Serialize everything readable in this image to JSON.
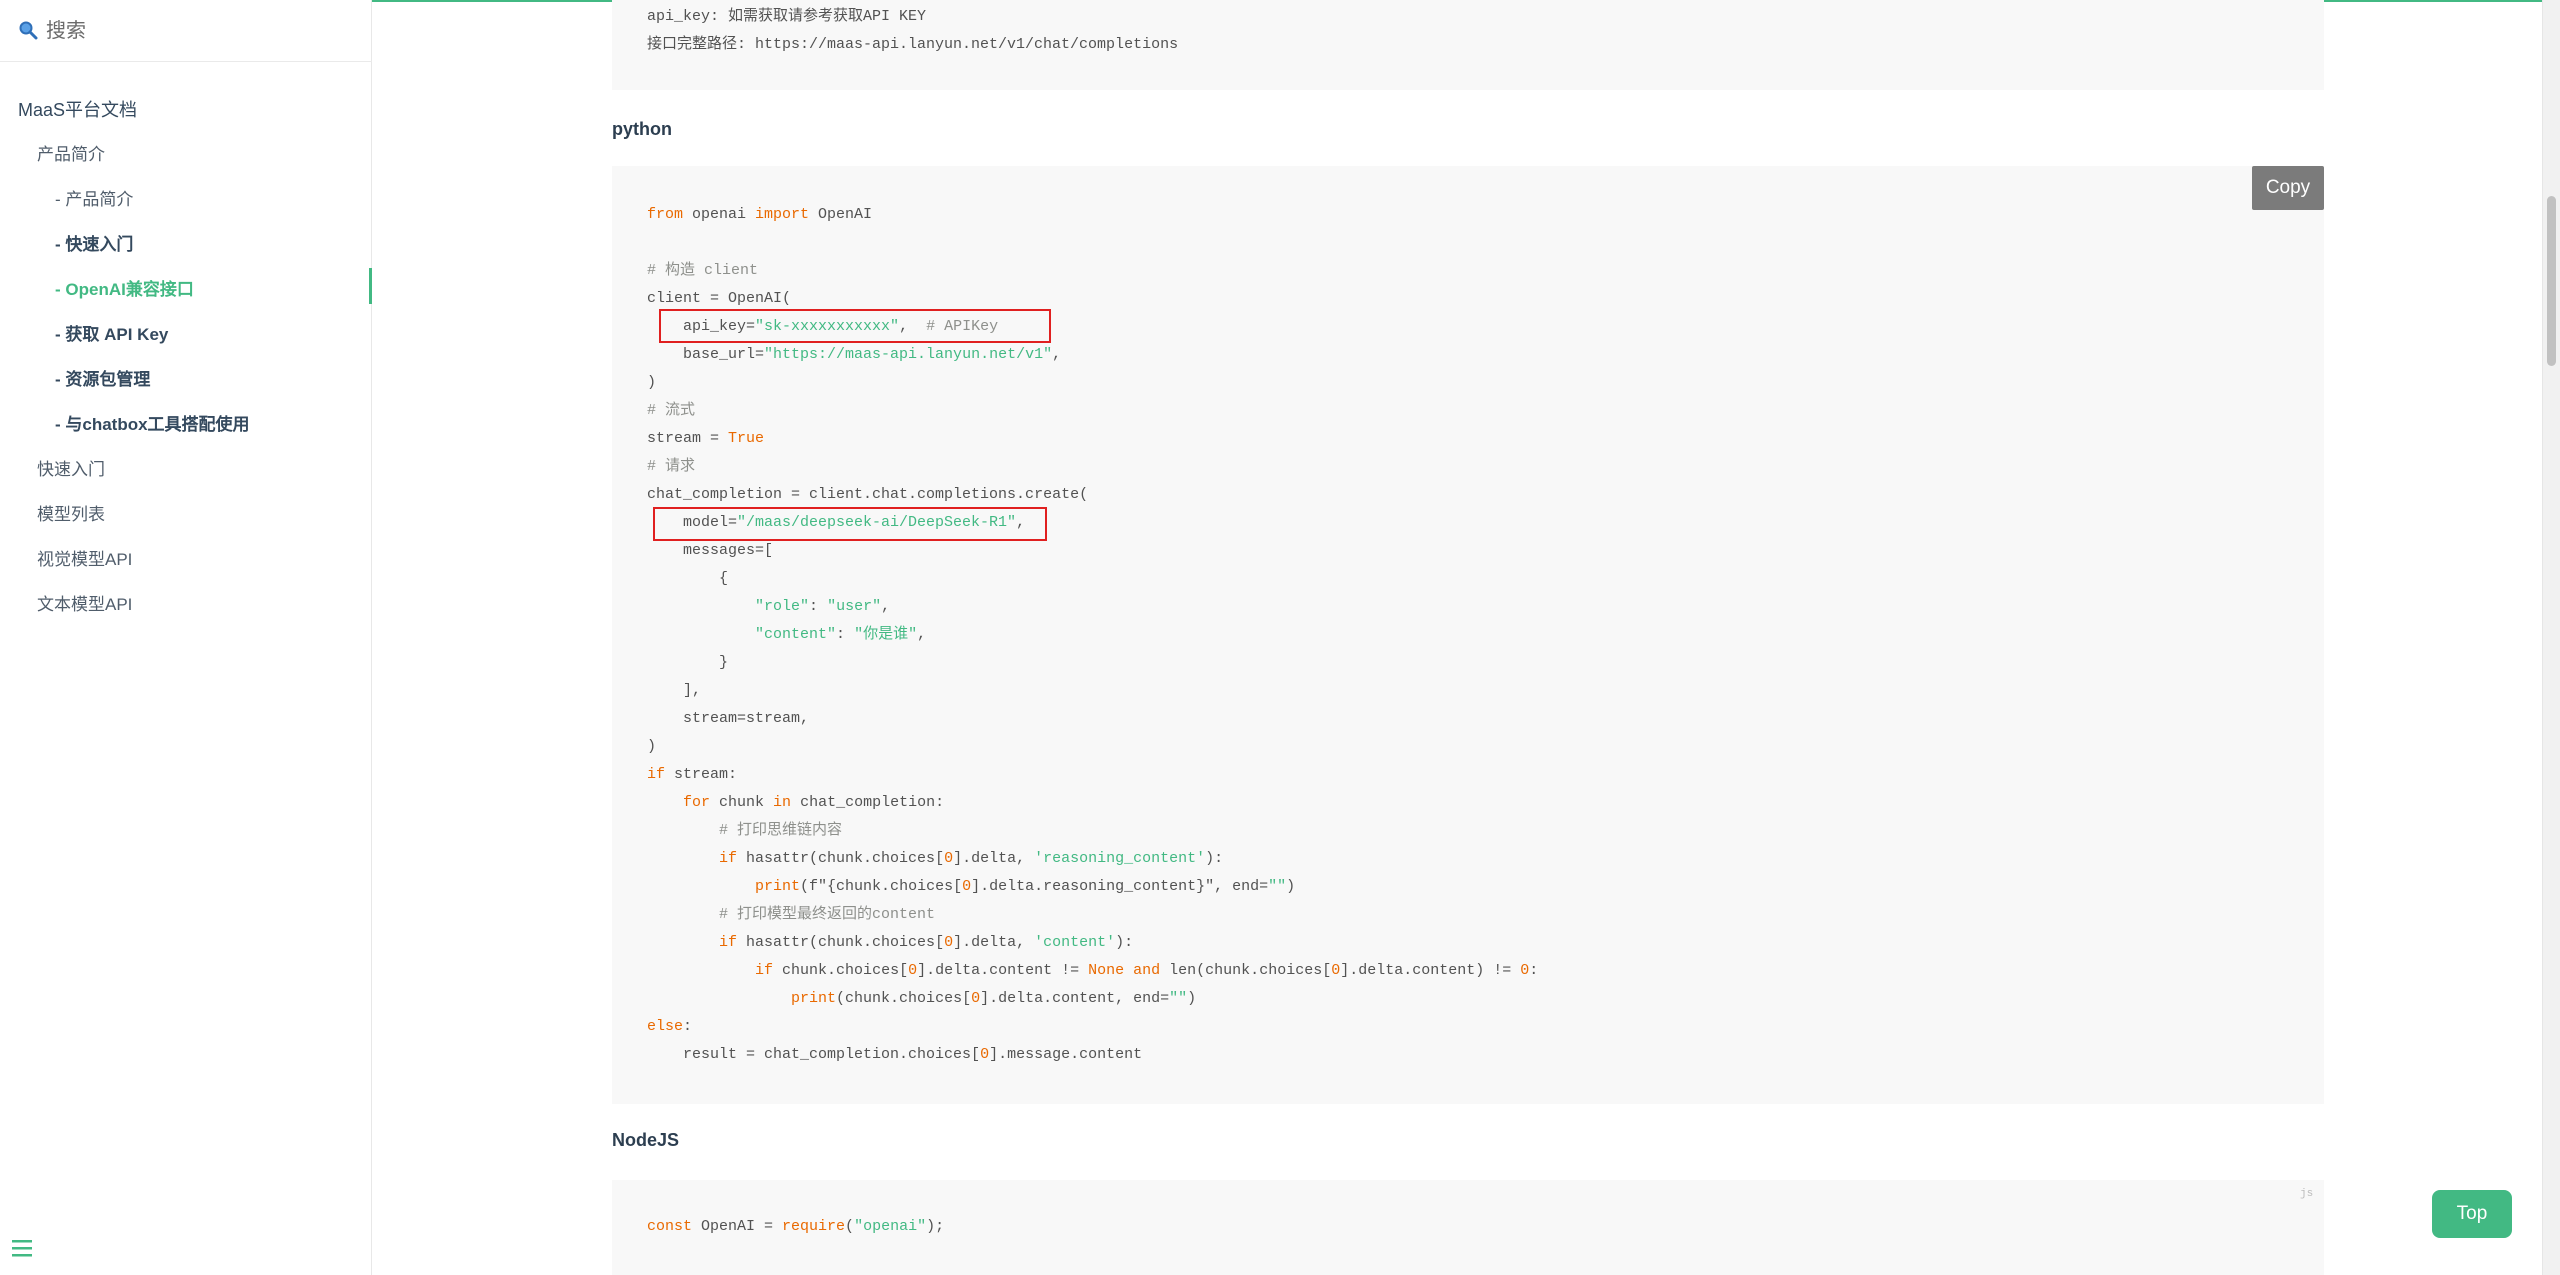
{
  "search": {
    "placeholder": "搜索"
  },
  "sidebar": {
    "root": "MaaS平台文档",
    "items": [
      {
        "label": "产品简介"
      },
      {
        "label": "- 产品简介"
      },
      {
        "label": "- 快速入门"
      },
      {
        "label": "- OpenAI兼容接口"
      },
      {
        "label": "- 获取 API Key"
      },
      {
        "label": "- 资源包管理"
      },
      {
        "label": "- 与chatbox工具搭配使用"
      },
      {
        "label": "快速入门"
      },
      {
        "label": "模型列表"
      },
      {
        "label": "视觉模型API"
      },
      {
        "label": "文本模型API"
      }
    ]
  },
  "top_code": {
    "line1": "api_key: 如需获取请参考获取API KEY",
    "line2": "接口完整路径: https://maas-api.lanyun.net/v1/chat/completions"
  },
  "python_section": {
    "heading": "python",
    "copy_label": "Copy"
  },
  "python_code": {
    "l1": [
      "from",
      " openai ",
      "import",
      " OpenAI"
    ],
    "l3": "# 构造 client",
    "l4": "client = OpenAI(",
    "l5": [
      "    api_key=",
      "\"sk-xxxxxxxxxxx\"",
      ",  ",
      "# APIKey"
    ],
    "l6": [
      "    base_url=",
      "\"https://maas-api.lanyun.net/v1\"",
      ","
    ],
    "l7": ")",
    "l8": "# 流式",
    "l9": [
      "stream = ",
      "True"
    ],
    "l10": "# 请求",
    "l11": "chat_completion = client.chat.completions.create(",
    "l12": [
      "    model=",
      "\"/maas/deepseek-ai/DeepSeek-R1\"",
      ","
    ],
    "l13": "    messages=[",
    "l14": "        {",
    "l15": [
      "            ",
      "\"role\"",
      ": ",
      "\"user\"",
      ","
    ],
    "l16": [
      "            ",
      "\"content\"",
      ": ",
      "\"你是谁\"",
      ","
    ],
    "l17": "        }",
    "l18": "    ],",
    "l19": "    stream=stream,",
    "l20": ")",
    "l21": [
      "if",
      " stream:"
    ],
    "l22": [
      "    ",
      "for",
      " chunk ",
      "in",
      " chat_completion:"
    ],
    "l23": "        # 打印思维链内容",
    "l24": [
      "        ",
      "if",
      " hasattr(chunk.choices[",
      "0",
      "].delta, ",
      "'reasoning_content'",
      "):"
    ],
    "l25": [
      "            ",
      "print",
      "(f\"{chunk.choices[",
      "0",
      "].delta.reasoning_content}\", end=",
      "\"\"",
      ")"
    ],
    "l26": "        # 打印模型最终返回的content",
    "l27": [
      "        ",
      "if",
      " hasattr(chunk.choices[",
      "0",
      "].delta, ",
      "'content'",
      "):"
    ],
    "l28": [
      "            ",
      "if",
      " chunk.choices[",
      "0",
      "].delta.content != ",
      "None",
      " ",
      "and",
      " len(chunk.choices[",
      "0",
      "].delta.content) != ",
      "0",
      ":"
    ],
    "l29": [
      "                ",
      "print",
      "(chunk.choices[",
      "0",
      "].delta.content, end=",
      "\"\"",
      ")"
    ],
    "l30": [
      "else",
      ":"
    ],
    "l31": [
      "    result = chat_completion.choices[",
      "0",
      "].message.content"
    ]
  },
  "node_section": {
    "heading": "NodeJS",
    "lang_tag": "js",
    "line1": [
      "const",
      " OpenAI = ",
      "require",
      "(",
      "\"openai\"",
      ");"
    ]
  },
  "top_button": {
    "label": "Top"
  },
  "colors": {
    "accent": "#42b983",
    "highlight": "#e02020",
    "keyword": "#e96900",
    "comment": "#8e908c"
  }
}
